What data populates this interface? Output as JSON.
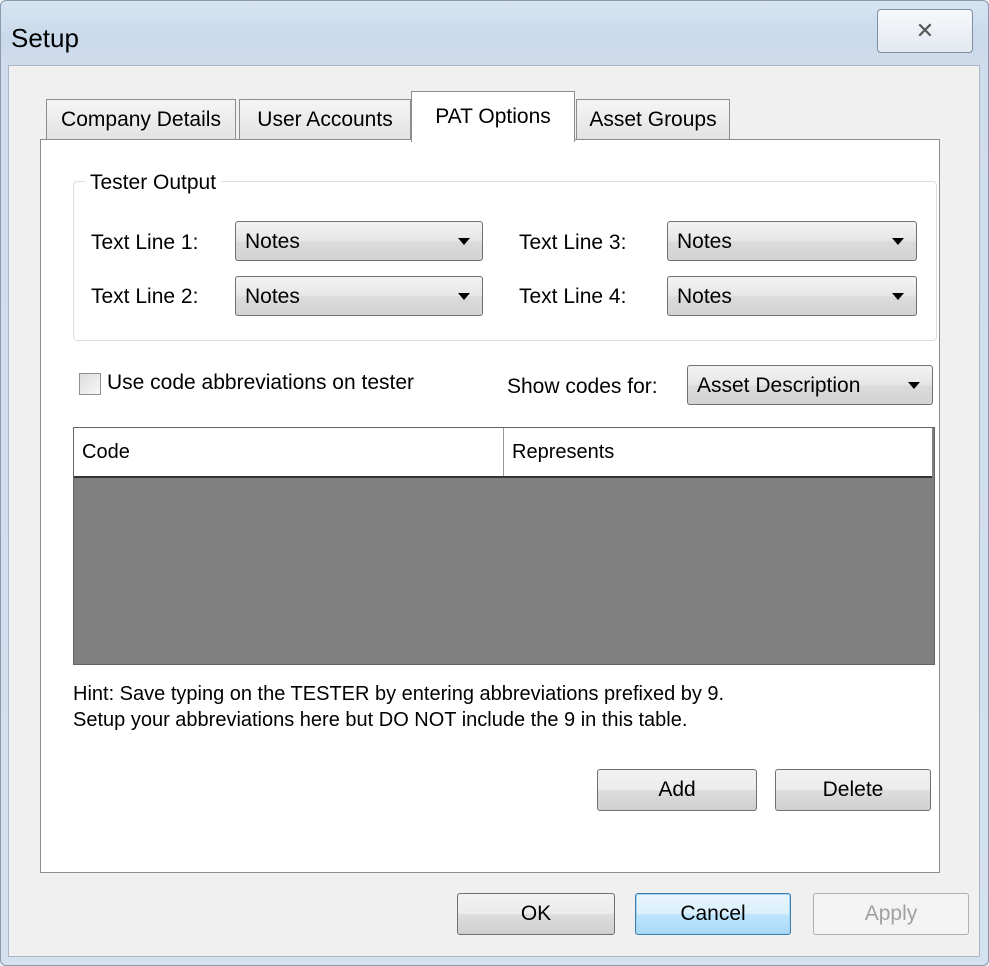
{
  "window": {
    "title": "Setup",
    "close_glyph": "✕"
  },
  "tabs": [
    {
      "label": "Company Details"
    },
    {
      "label": "User Accounts"
    },
    {
      "label": "PAT Options"
    },
    {
      "label": "Asset Groups"
    }
  ],
  "active_tab": "PAT Options",
  "tester_output": {
    "legend": "Tester Output",
    "lines": [
      {
        "label": "Text Line 1:",
        "value": "Notes"
      },
      {
        "label": "Text Line 2:",
        "value": "Notes"
      },
      {
        "label": "Text Line 3:",
        "value": "Notes"
      },
      {
        "label": "Text Line 4:",
        "value": "Notes"
      }
    ]
  },
  "abbrev": {
    "checkbox_label": "Use code abbreviations on tester",
    "checked": false
  },
  "show_codes": {
    "label": "Show codes for:",
    "value": "Asset Description"
  },
  "table": {
    "columns": [
      "Code",
      "Represents"
    ],
    "rows": []
  },
  "hint": {
    "line1": "Hint: Save typing on the TESTER by entering abbreviations prefixed by 9.",
    "line2": "Setup your abbreviations here but DO NOT include the 9 in this table."
  },
  "buttons": {
    "add": "Add",
    "delete": "Delete",
    "ok": "OK",
    "cancel": "Cancel",
    "apply": "Apply"
  },
  "icons": {
    "close": "close-icon",
    "dropdown": "chevron-down-icon"
  }
}
